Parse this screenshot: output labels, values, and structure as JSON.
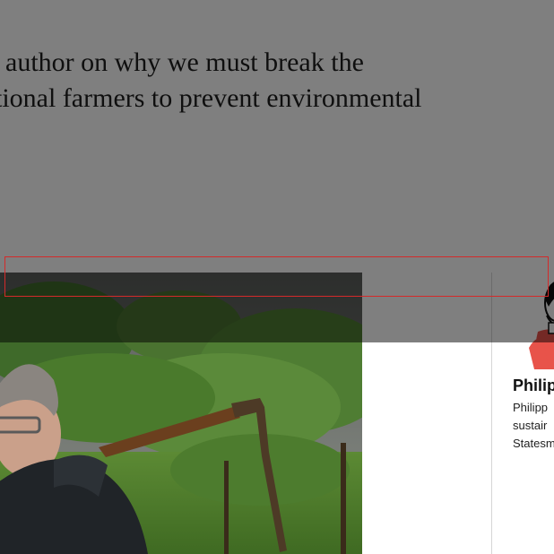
{
  "article": {
    "subtitle_line1": "author on why we must break the",
    "subtitle_line2": "tional farmers to prevent environmental"
  },
  "author": {
    "name": "Philip",
    "bio_lines": [
      "Philipp",
      "sustair",
      "Statesm"
    ]
  },
  "colors": {
    "overlay": "#000000",
    "focus_outline": "#d42a2a",
    "portrait_accent": "#e8534a",
    "divider": "#d6d6d6"
  },
  "icons": {
    "author_portrait": "illustrated-portrait-icon"
  }
}
